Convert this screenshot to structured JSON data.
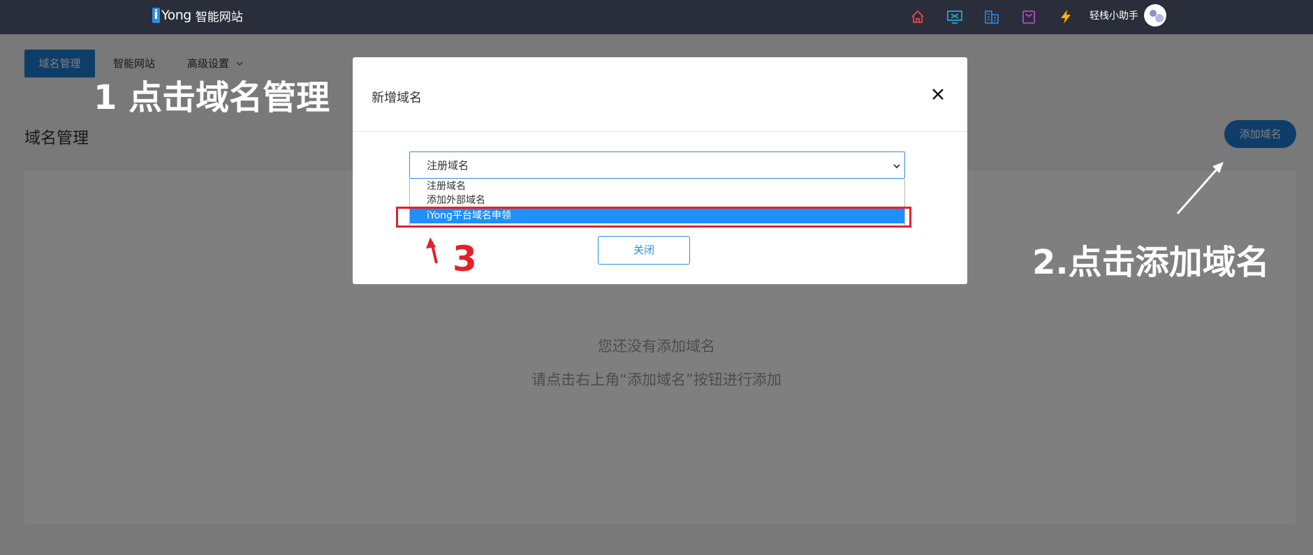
{
  "header": {
    "logo_mark": "i",
    "logo_text": "Yong",
    "logo_sub": "智能网站",
    "icons": [
      "home-icon",
      "monitor-icon",
      "building-icon",
      "bag-icon",
      "lightning-icon"
    ],
    "icon_colors": [
      "#e5484d",
      "#25a9c9",
      "#2f7ed8",
      "#b04ac9",
      "#f4b400"
    ],
    "user_name": "轻栈小助手"
  },
  "nav": {
    "active": "域名管理",
    "link1": "智能网站",
    "link2": "高级设置"
  },
  "main": {
    "title": "域名管理",
    "add_button": "添加域名",
    "empty_line1": "您还没有添加域名",
    "empty_line2": "请点击右上角“添加域名”按钮进行添加"
  },
  "modal": {
    "title": "新增域名",
    "select_value": "注册域名",
    "options": [
      "注册域名",
      "添加外部域名",
      "iYong平台域名申领"
    ],
    "selected_option_index": 2,
    "close_button": "关闭"
  },
  "annotations": {
    "step1": "1 点击域名管理",
    "step2": "2.点击添加域名",
    "step3": "3",
    "color_red": "#e2212b"
  }
}
